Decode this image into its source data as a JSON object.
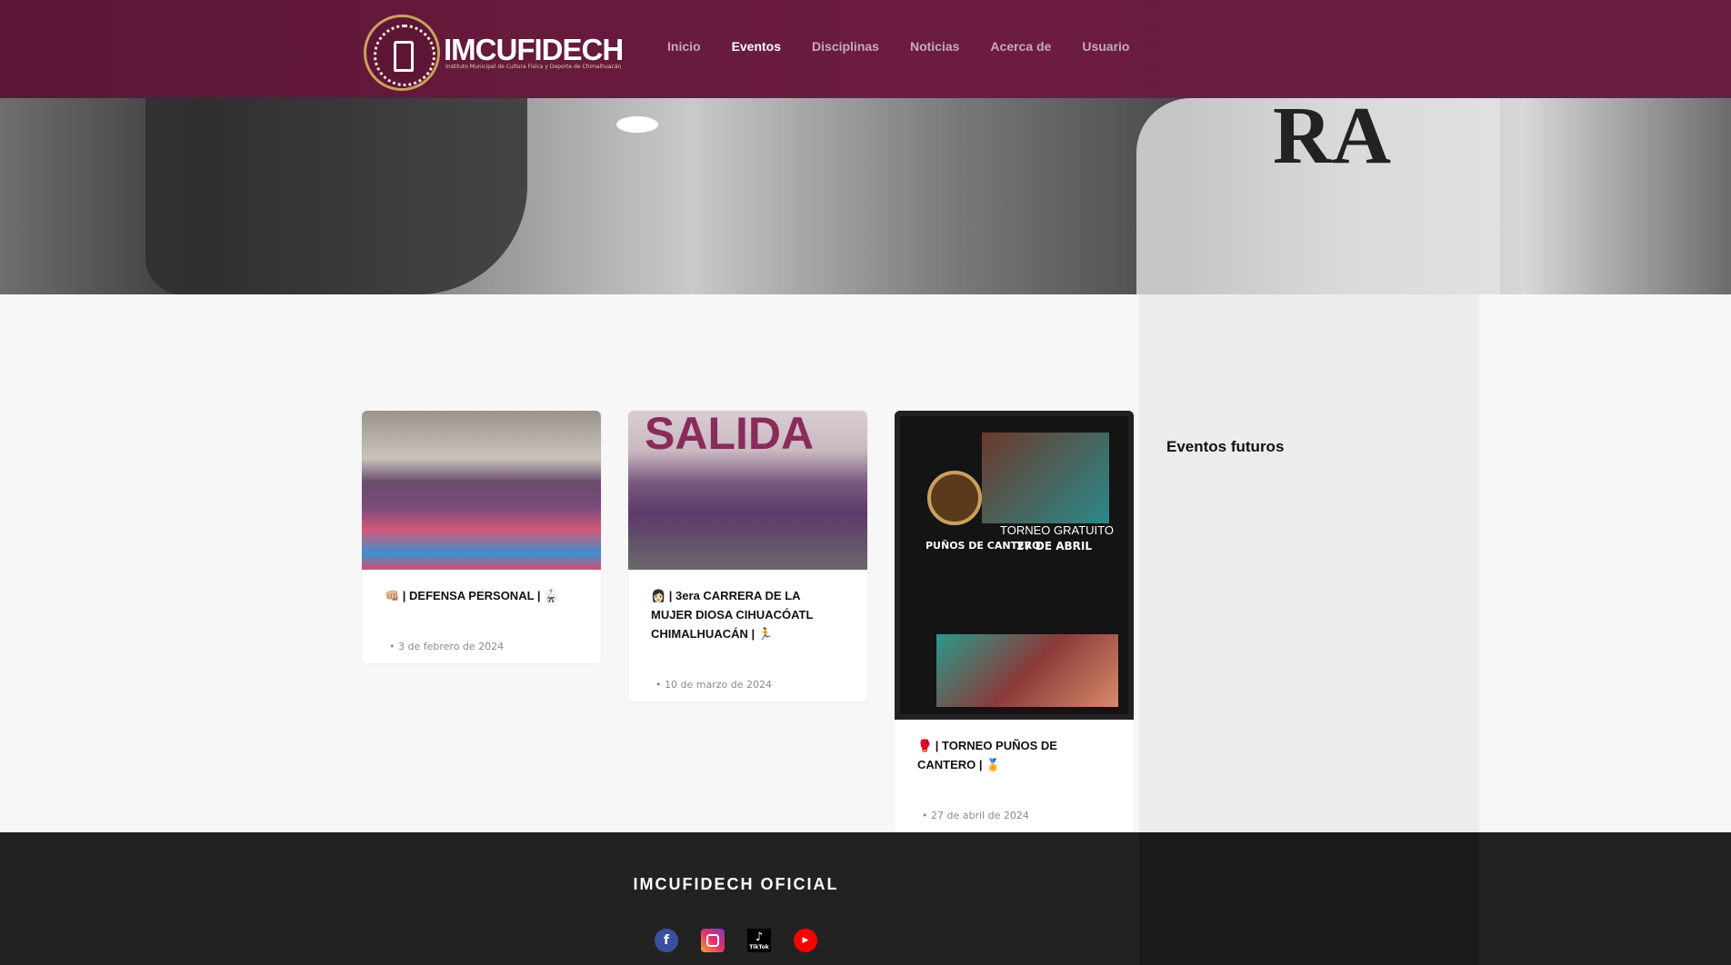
{
  "header": {
    "logo_text": "IMCUFIDECH",
    "logo_subtitle": "Instituto Municipal de Cultura Física y Deporte de Chimalhuacán",
    "nav": [
      {
        "label": "Inicio"
      },
      {
        "label": "Eventos",
        "active": true
      },
      {
        "label": "Disciplinas"
      },
      {
        "label": "Noticias"
      },
      {
        "label": "Acerca de"
      },
      {
        "label": "Usuario"
      }
    ]
  },
  "events": [
    {
      "title": "👊🏼 | DEFENSA PERSONAL | 🥋",
      "date": "3 de febrero de 2024"
    },
    {
      "title": "👩🏻 | 3era CARRERA DE LA MUJER DIOSA CIHUACÓATL CHIMALHUACÁN | 🏃",
      "date": "10 de marzo de 2024",
      "image_text": "SALIDA"
    },
    {
      "title": "🥊 | TORNEO PUÑOS DE CANTERO | 🏅",
      "date": "27 de abril de 2024",
      "image_text": {
        "heading": "TORNEO GRATUITO",
        "date": "27 DE ABRIL",
        "brand": "PUÑOS DE CANTERO"
      }
    }
  ],
  "sidebar": {
    "title": "Eventos futuros"
  },
  "footer": {
    "title": "IMCUFIDECH OFICIAL",
    "social": [
      {
        "icon": "facebook-icon",
        "color": "#3b4fa0"
      },
      {
        "icon": "instagram-icon",
        "color": "#c13584"
      },
      {
        "icon": "tiktok-icon",
        "label": "TikTok",
        "color": "#000000"
      },
      {
        "icon": "youtube-icon",
        "color": "#ff0000"
      }
    ]
  },
  "colors": {
    "brand": "#6b1c40",
    "footer": "#222222"
  }
}
